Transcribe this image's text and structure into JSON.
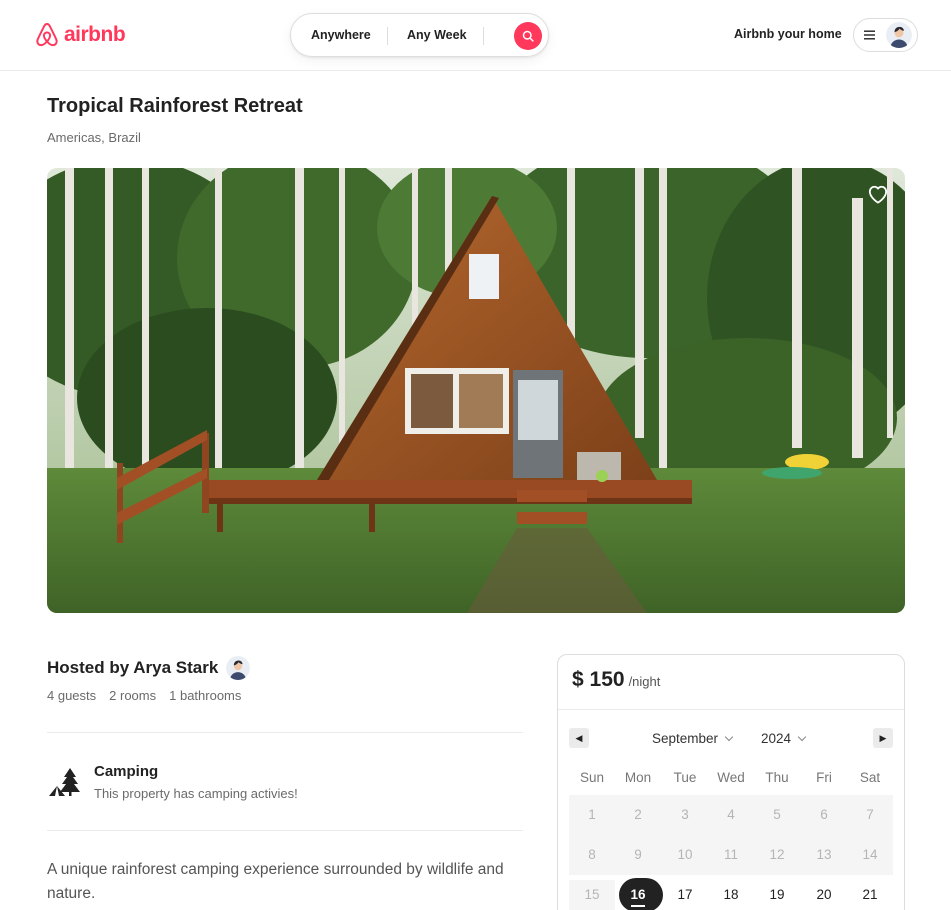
{
  "header": {
    "logo_text": "airbnb",
    "search": {
      "anywhere": "Anywhere",
      "any_week": "Any Week"
    },
    "host_link": "Airbnb your home"
  },
  "listing": {
    "title": "Tropical Rainforest Retreat",
    "location": "Americas, Brazil",
    "host_line": "Hosted by Arya Stark",
    "stats": [
      "4 guests",
      "2 rooms",
      "1 bathrooms"
    ],
    "feature": {
      "title": "Camping",
      "description": "This property has camping activies!"
    },
    "description": "A unique rainforest camping experience surrounded by wildlife and nature."
  },
  "booking": {
    "price": "$ 150",
    "unit": "/night",
    "month": "September",
    "year": "2024",
    "weekdays": [
      "Sun",
      "Mon",
      "Tue",
      "Wed",
      "Thu",
      "Fri",
      "Sat"
    ],
    "rows": [
      [
        "1",
        "2",
        "3",
        "4",
        "5",
        "6",
        "7"
      ],
      [
        "8",
        "9",
        "10",
        "11",
        "12",
        "13",
        "14"
      ],
      [
        "15",
        "16",
        "17",
        "18",
        "19",
        "20",
        "21"
      ]
    ],
    "selected_day": "16"
  },
  "colors": {
    "brand": "#FF385C",
    "text": "#222222",
    "muted": "#6A6A6A"
  }
}
